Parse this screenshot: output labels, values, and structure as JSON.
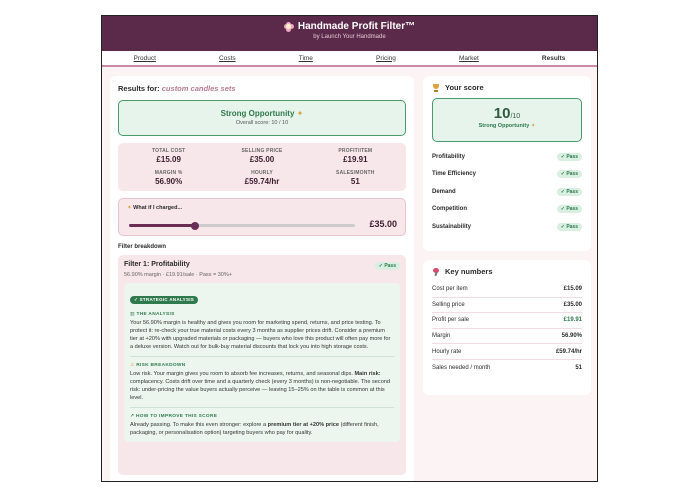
{
  "header": {
    "title": "Handmade Profit Filter™",
    "subtitle": "by Launch Your Handmade"
  },
  "nav": {
    "tabs": [
      {
        "label": "Product"
      },
      {
        "label": "Costs"
      },
      {
        "label": "Time"
      },
      {
        "label": "Pricing"
      },
      {
        "label": "Market"
      },
      {
        "label": "Results"
      }
    ],
    "active": "Results"
  },
  "results": {
    "label": "Results for:",
    "product": "custom candles sets",
    "verdict": "Strong Opportunity",
    "verdict_icon": "party-icon",
    "overall": "Overall score: 10 / 10",
    "stats": [
      {
        "label": "TOTAL COST",
        "value": "£15.09"
      },
      {
        "label": "SELLING PRICE",
        "value": "£35.00"
      },
      {
        "label": "PROFIT/ITEM",
        "value": "£19.91"
      },
      {
        "label": "MARGIN %",
        "value": "56.90%"
      },
      {
        "label": "HOURLY",
        "value": "£59.74/hr"
      },
      {
        "label": "SALES/MONTH",
        "value": "51"
      }
    ],
    "whatif_label": "What if I charged...",
    "whatif_price": "£35.00",
    "slider_fraction": 0.29
  },
  "breakdown": {
    "title": "Filter breakdown",
    "filter": {
      "name": "Filter 1: Profitability",
      "status": "✓ Pass",
      "summary": "56.90% margin · £19.91/sale · Pass = 30%+",
      "tag": "✓ STRATEGIC ANALYSIS",
      "analysis_title": "THE ANALYSIS",
      "analysis_text": "Your 56.90% margin is healthy and gives you room for marketing spend, returns, and price testing. To protect it: re-check your true material costs every 3 months as supplier prices drift. Consider a premium tier at +20% with upgraded materials or packaging — buyers who love this product will often pay more for a deluxe version. Watch out for bulk-buy material discounts that lock you into high storage costs.",
      "risk_title": "RISK BREAKDOWN",
      "risk_text_1": "Low risk. Your margin gives you room to absorb fee increases, returns, and seasonal dips.",
      "risk_main_label": "Main risk:",
      "risk_text_2": "complacency. Costs drift over time and a quarterly check (every 3 months) is non-negotiable. The second risk: under-pricing the value buyers actually perceive — leaving 15–25% on the table is common at this level.",
      "improve_title": "HOW TO IMPROVE THIS SCORE",
      "improve_text_1": "Already passing. To make this even stronger: explore a",
      "improve_bold": "premium tier at +20% price",
      "improve_text_2": "(different finish, packaging, or personalisation option) targeting buyers who pay for quality."
    }
  },
  "score": {
    "title": "Your score",
    "value": "10",
    "out_of": "/10",
    "label": "Strong Opportunity",
    "criteria": [
      {
        "name": "Profitability",
        "status": "✓ Pass"
      },
      {
        "name": "Time Efficiency",
        "status": "✓ Pass"
      },
      {
        "name": "Demand",
        "status": "✓ Pass"
      },
      {
        "name": "Competition",
        "status": "✓ Pass"
      },
      {
        "name": "Sustainability",
        "status": "✓ Pass"
      }
    ]
  },
  "key_numbers": {
    "title": "Key numbers",
    "rows": [
      {
        "label": "Cost per item",
        "value": "£15.09"
      },
      {
        "label": "Selling price",
        "value": "£35.00"
      },
      {
        "label": "Profit per sale",
        "value": "£19.91"
      },
      {
        "label": "Margin",
        "value": "56.90%"
      },
      {
        "label": "Hourly rate",
        "value": "£59.74/hr"
      },
      {
        "label": "Sales needed / month",
        "value": "51"
      }
    ]
  },
  "colors": {
    "header_bg": "#5b2a4a",
    "accent_green": "#2f7a4d",
    "panel_pink": "#f7e6ea"
  }
}
